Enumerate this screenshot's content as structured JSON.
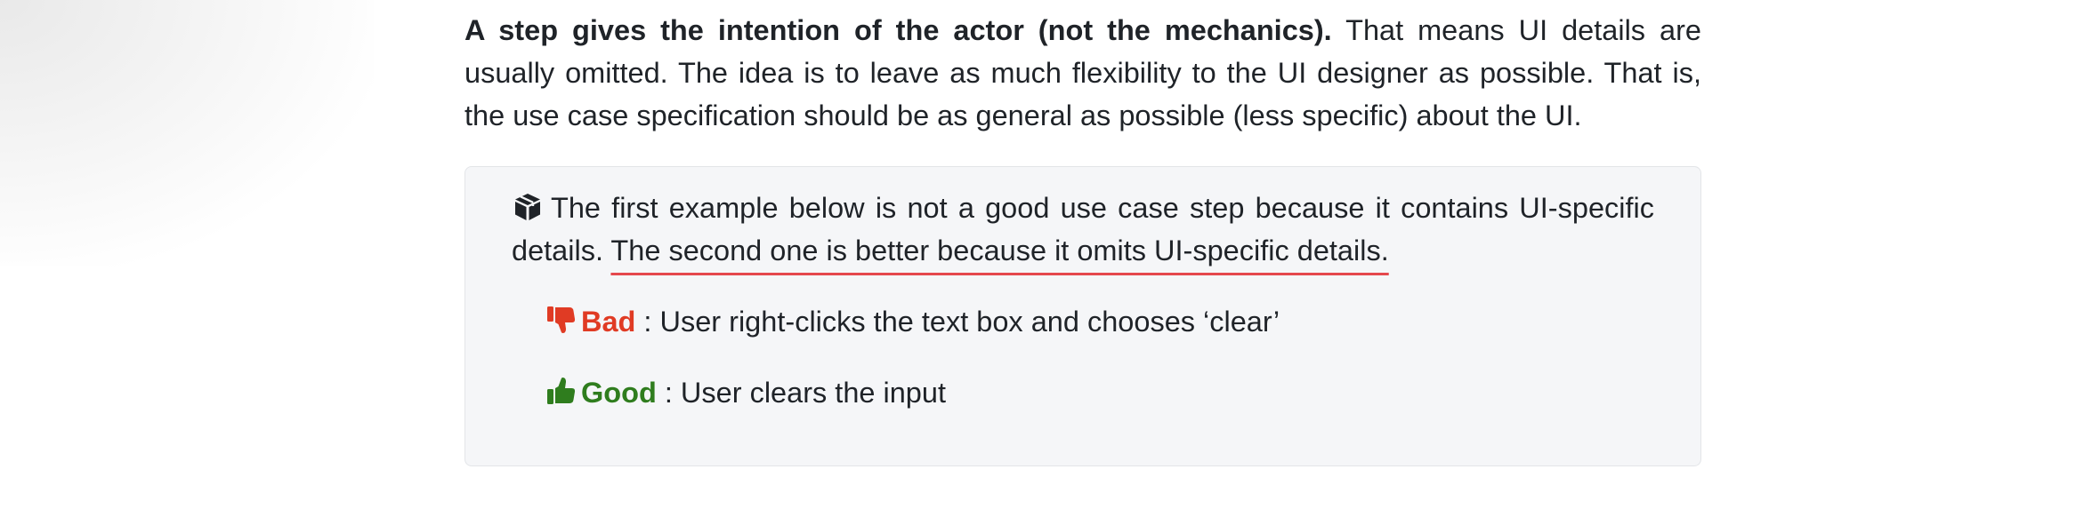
{
  "intro": {
    "bold_lead": "A step gives the intention of the actor (not the mechanics).",
    "rest": " That means UI details are usually omitted. The idea is to leave as much flexibility to the UI designer as possible. That is, the use case specification should be as general as possible (less specific) about the UI."
  },
  "callout": {
    "icon": "box-icon",
    "text_before": "The first example below is not a good use case step because it contains UI-specific details. ",
    "text_underlined": "The second one is better because it omits UI-specific details.",
    "underline_color": "#e5484d",
    "background_color": "#f5f6f8"
  },
  "examples": [
    {
      "icon": "thumbs-down-icon",
      "label": "Bad",
      "text": " : User right-clicks the text box and chooses ‘clear’",
      "color": "#e03b24"
    },
    {
      "icon": "thumbs-up-icon",
      "label": "Good",
      "text": " : User clears the input",
      "color": "#2f7d1e"
    }
  ]
}
